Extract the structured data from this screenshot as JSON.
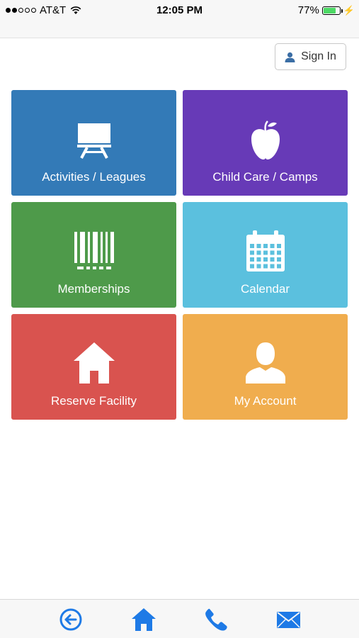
{
  "status_bar": {
    "carrier": "AT&T",
    "time": "12:05 PM",
    "battery": "77%",
    "battery_level": 0.77,
    "signal_bars": 2
  },
  "header": {
    "signin_label": "Sign In"
  },
  "tiles": [
    {
      "label": "Activities / Leagues",
      "color": "#337ab7",
      "icon": "easel-icon"
    },
    {
      "label": "Child Care / Camps",
      "color": "#673ab7",
      "icon": "apple-icon"
    },
    {
      "label": "Memberships",
      "color": "#4e9a4a",
      "icon": "barcode-icon"
    },
    {
      "label": "Calendar",
      "color": "#5bc0de",
      "icon": "calendar-icon"
    },
    {
      "label": "Reserve Facility",
      "color": "#d9534f",
      "icon": "house-icon"
    },
    {
      "label": "My Account",
      "color": "#f0ad4e",
      "icon": "user-icon"
    }
  ],
  "tab_bar": {
    "items": [
      "back-icon",
      "home-icon",
      "phone-icon",
      "mail-icon"
    ],
    "color": "#1e7ae6"
  }
}
